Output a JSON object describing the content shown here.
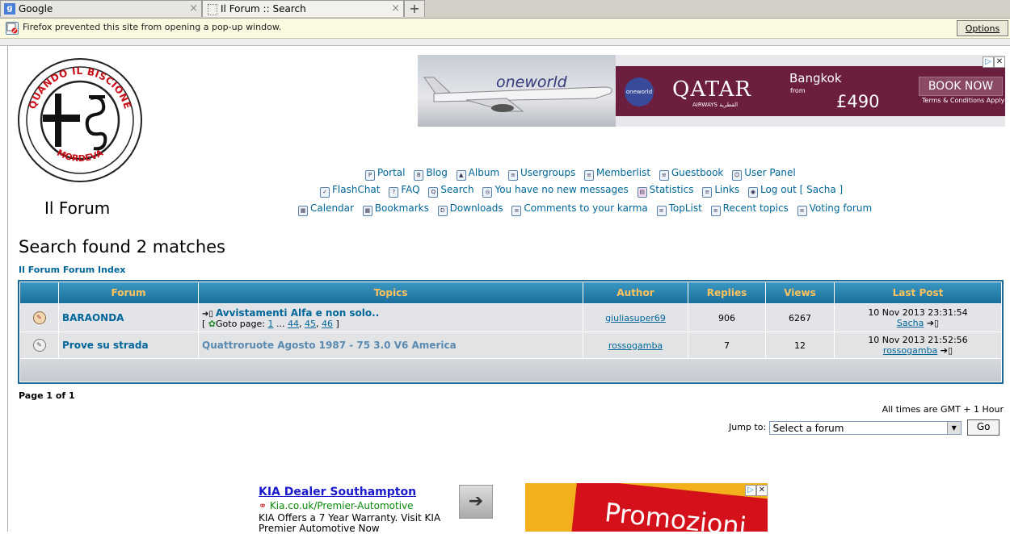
{
  "browser": {
    "tabs": [
      {
        "label": "Google",
        "icon": "google-icon"
      },
      {
        "label": "Il Forum :: Search",
        "icon": "page-icon"
      }
    ],
    "new_tab": "+",
    "close_glyph": "×",
    "notification": "Firefox prevented this site from opening a pop-up window.",
    "options_label": "Options"
  },
  "logo": {
    "top_text": "QUANDO IL BISCIONE",
    "bottom_text": "MORDEVA"
  },
  "site_title": "Il Forum",
  "banner_ad": {
    "oneworld": "oneworld",
    "badge": "oneworld",
    "brand": "QATAR",
    "brand_sub": "AIRWAYS القطرية",
    "city": "Bangkok",
    "from": "from",
    "price": "£490",
    "cta": "BOOK NOW",
    "terms": "Terms & Conditions Apply"
  },
  "nav": {
    "row1": [
      "Portal",
      "Blog",
      "Album",
      "Usergroups",
      "Memberlist",
      "Guestbook",
      "User Panel"
    ],
    "row2": [
      "FlashChat",
      "FAQ",
      "Search",
      "You have no new messages",
      "Statistics",
      "Links",
      "Log out [ Sacha ]"
    ],
    "row3": [
      "Calendar",
      "Bookmarks",
      "Downloads",
      "Comments to your karma",
      "TopList",
      "Recent topics",
      "Voting forum"
    ]
  },
  "search": {
    "heading": "Search found 2 matches",
    "breadcrumb": "Il Forum Forum Index"
  },
  "table": {
    "headers": [
      "Forum",
      "Topics",
      "Author",
      "Replies",
      "Views",
      "Last Post"
    ],
    "rows": [
      {
        "forum": "BARAONDA",
        "topic": "Avvistamenti Alfa e non solo..",
        "goto_prefix": "[",
        "goto_label": "Goto page:",
        "goto_pages": [
          "1",
          "44",
          "45",
          "46"
        ],
        "goto_ellipsis": "...",
        "goto_suffix": "]",
        "author": "giuliasuper69",
        "replies": "906",
        "views": "6267",
        "last_date": "10 Nov 2013 23:31:54",
        "last_user": "Sacha"
      },
      {
        "forum": "Prove su strada",
        "topic": "Quattroruote Agosto 1987 - 75 3.0 V6 America",
        "author": "rossogamba",
        "replies": "7",
        "views": "12",
        "last_date": "10 Nov 2013 21:52:56",
        "last_user": "rossogamba"
      }
    ]
  },
  "footer": {
    "pagination": "Page 1 of 1",
    "timezone": "All times are GMT + 1 Hour",
    "jump_label": "Jump to:",
    "jump_selected": "Select a forum",
    "go_label": "Go"
  },
  "bottom_ad": {
    "title": "KIA Dealer Southampton",
    "url": "Kia.co.uk/Premier-Automotive",
    "desc": "KIA Offers a 7 Year Warranty. Visit KIA Premier Automotive Now",
    "promo_text": "Promozioni"
  }
}
